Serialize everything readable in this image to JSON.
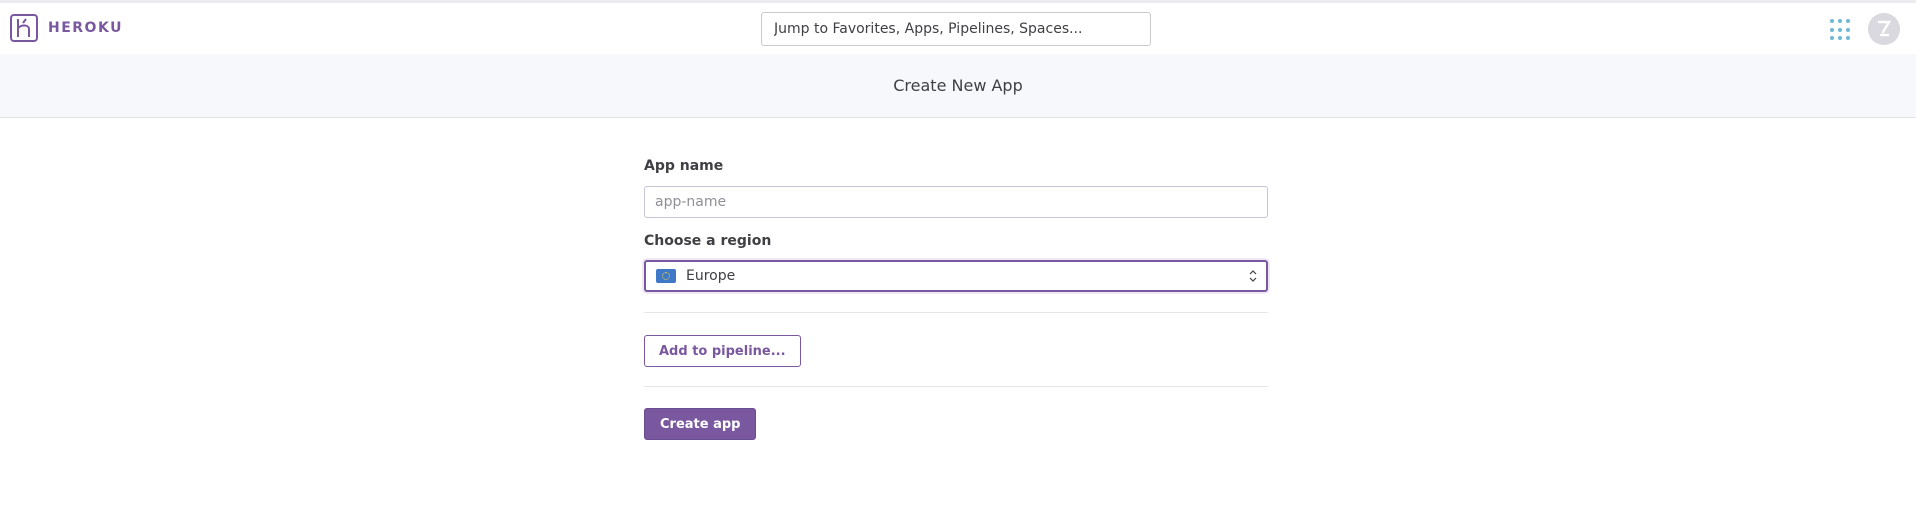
{
  "brand": {
    "name": "HEROKU",
    "color": "#79589f"
  },
  "topnav": {
    "search_placeholder": "Jump to Favorites, Apps, Pipelines, Spaces...",
    "apps_icon": "grid-dots-icon",
    "avatar_icon": "user-avatar-icon"
  },
  "page": {
    "title": "Create New App"
  },
  "form": {
    "app_name": {
      "label": "App name",
      "placeholder": "app-name",
      "value": ""
    },
    "region": {
      "label": "Choose a region",
      "selected": "Europe",
      "icon": "eu-flag-icon"
    },
    "add_pipeline_label": "Add to pipeline...",
    "create_label": "Create app"
  },
  "colors": {
    "accent": "#79589f",
    "link_blue": "#6fb8d6"
  }
}
